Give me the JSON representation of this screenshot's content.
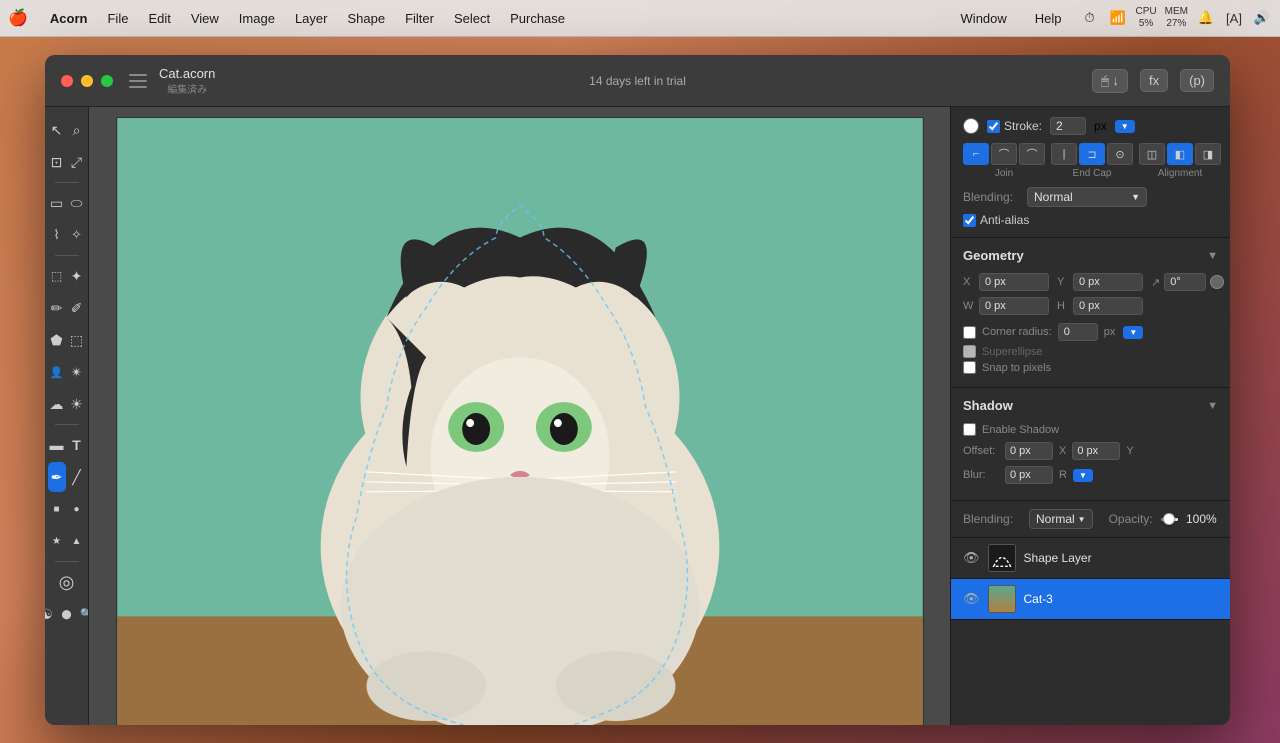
{
  "menubar": {
    "apple": "🍎",
    "items": [
      "Acorn",
      "File",
      "Edit",
      "View",
      "Image",
      "Layer",
      "Shape",
      "Filter",
      "Select",
      "Purchase"
    ],
    "right": {
      "window": "Window",
      "help": "Help",
      "cpu_label": "CPU",
      "cpu_value": "5%",
      "mem_label": "MEM",
      "mem_value": "27%"
    }
  },
  "titlebar": {
    "close": "",
    "minimize": "",
    "maximize": "",
    "filename": "Cat.acorn",
    "subtitle": "編集済み",
    "trial": "14 days left in trial",
    "tool1": "🖱",
    "tool2": "fx",
    "tool3": "(p)"
  },
  "right_panel": {
    "stroke": {
      "label": "Stroke:",
      "enabled": true,
      "value": "2",
      "unit": "px"
    },
    "join_label": "Join",
    "end_cap_label": "End Cap",
    "alignment_label": "Alignment",
    "blending_label": "Blending:",
    "blending_value": "Normal",
    "anti_alias_label": "Anti-alias",
    "anti_alias_enabled": true,
    "geometry": {
      "title": "Geometry",
      "x_label": "X",
      "x_value": "0 px",
      "y_label": "Y",
      "y_value": "0 px",
      "angle_value": "0°",
      "w_label": "W",
      "w_value": "0 px",
      "h_label": "H",
      "h_value": "0 px",
      "corner_radius_label": "Corner radius:",
      "corner_radius_value": "0",
      "corner_radius_unit": "px",
      "superellipse_label": "Superellipse",
      "snap_label": "Snap to pixels"
    },
    "shadow": {
      "title": "Shadow",
      "enable_label": "Enable Shadow",
      "offset_label": "Offset:",
      "offset_x": "0 px",
      "offset_y": "0 px",
      "x_label": "X",
      "y_label": "Y",
      "blur_label": "Blur:",
      "blur_value": "0 px",
      "blur_unit": "R"
    },
    "opacity": {
      "blending_label": "Blending:",
      "blending_value": "Normal",
      "opacity_label": "Opacity:",
      "opacity_value": "100%"
    },
    "layers": [
      {
        "name": "Shape Layer",
        "visible": true,
        "active": false,
        "type": "shape"
      },
      {
        "name": "Cat-3",
        "visible": true,
        "active": true,
        "type": "cat"
      }
    ]
  },
  "toolbar": {
    "tools": [
      {
        "id": "arrow",
        "label": "Arrow"
      },
      {
        "id": "zoom",
        "label": "Zoom"
      },
      {
        "id": "crop",
        "label": "Crop"
      },
      {
        "id": "transform",
        "label": "Transform"
      },
      {
        "id": "rect-sel",
        "label": "Rect Select"
      },
      {
        "id": "ellipse-sel",
        "label": "Ellipse Select"
      },
      {
        "id": "lasso",
        "label": "Lasso"
      },
      {
        "id": "mag-lasso",
        "label": "Magnetic Lasso"
      },
      {
        "id": "eyedrop",
        "label": "Eyedropper"
      },
      {
        "id": "wand",
        "label": "Magic Wand"
      },
      {
        "id": "brush",
        "label": "Brush"
      },
      {
        "id": "pencil",
        "label": "Pencil"
      },
      {
        "id": "fill",
        "label": "Fill"
      },
      {
        "id": "eraser",
        "label": "Eraser"
      },
      {
        "id": "person",
        "label": "Person"
      },
      {
        "id": "effects",
        "label": "Effects"
      },
      {
        "id": "light",
        "label": "Light"
      },
      {
        "id": "cloud",
        "label": "Cloud"
      },
      {
        "id": "rect2",
        "label": "Rectangle"
      },
      {
        "id": "text",
        "label": "Text"
      },
      {
        "id": "pen",
        "label": "Pen",
        "active": true
      },
      {
        "id": "line",
        "label": "Line"
      },
      {
        "id": "sq",
        "label": "Square"
      },
      {
        "id": "circ",
        "label": "Circle"
      },
      {
        "id": "star",
        "label": "Star"
      },
      {
        "id": "up",
        "label": "Polygon"
      },
      {
        "id": "circle-bold",
        "label": "Record"
      },
      {
        "id": "yin",
        "label": "Yin Yang"
      },
      {
        "id": "dot",
        "label": "Dot"
      },
      {
        "id": "search",
        "label": "Search"
      }
    ]
  }
}
